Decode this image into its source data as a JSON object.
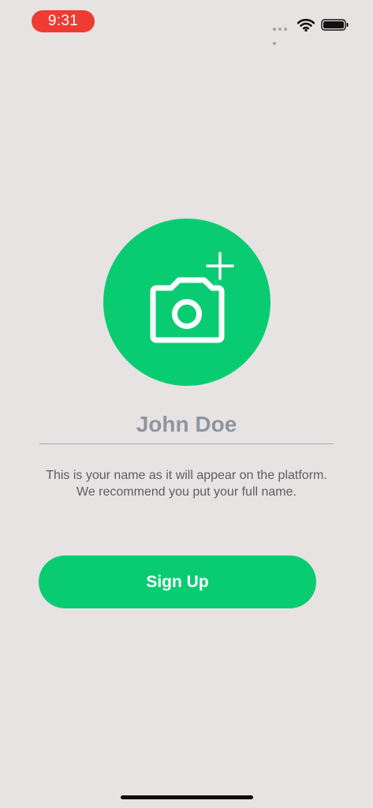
{
  "status_bar": {
    "time": "9:31",
    "time_pill_color": "#ee3b33",
    "icons": [
      "cellular-dots-icon",
      "wifi-icon",
      "battery-icon"
    ]
  },
  "profile": {
    "avatar_icon": "camera-add-icon",
    "accent_color": "#09cc72",
    "name_placeholder": "John Doe",
    "helper_line_1": "This is your name as it will appear on the platform.",
    "helper_line_2": "We recommend you put your full name."
  },
  "actions": {
    "signup_label": "Sign Up"
  }
}
